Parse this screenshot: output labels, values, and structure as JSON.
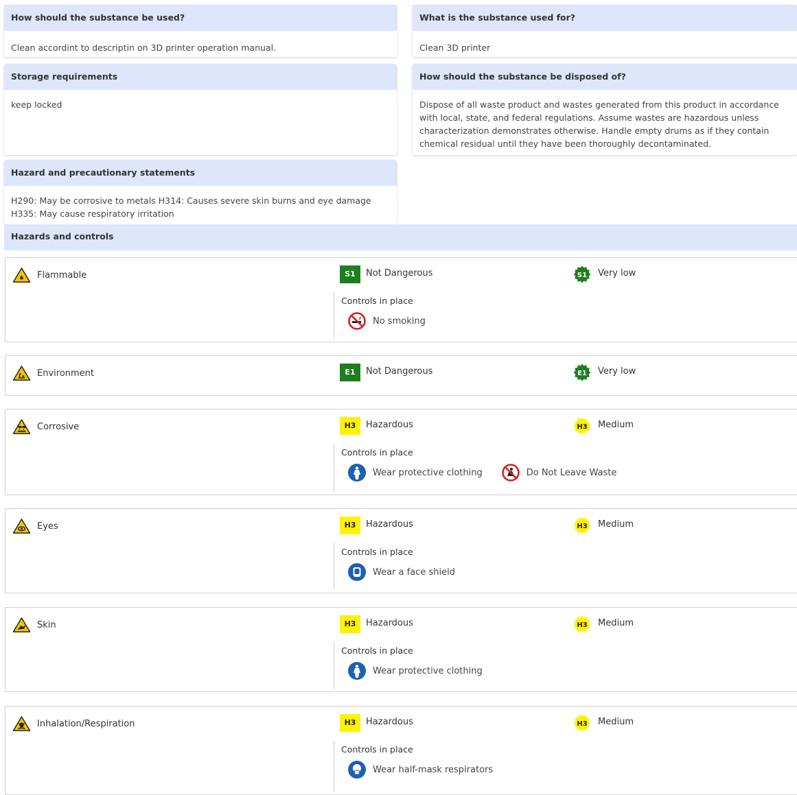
{
  "usage": {
    "title": "How should the substance be used?",
    "text": "Clean accordint to descriptin on 3D printer operation manual."
  },
  "purpose": {
    "title": "What is the substance used for?",
    "text": "Clean 3D printer"
  },
  "storage": {
    "title": "Storage requirements",
    "text": "keep locked"
  },
  "disposal": {
    "title": "How should the substance be disposed of?",
    "text": "Dispose of all waste product and wastes generated from this product in accordance with local, state, and federal regulations. Assume wastes are hazardous unless characterization demonstrates otherwise. Handle empty drums as if they contain chemical residual until they have been thoroughly decontaminated."
  },
  "statements": {
    "title": "Hazard and precautionary statements",
    "text": "H290: May be corrosive to metals H314: Causes severe skin burns and eye damage H335: May cause respiratory irritation"
  },
  "hazards_title": "Hazards and controls",
  "controls_label": "Controls in place",
  "colors": {
    "header_bg": "#dde6fb",
    "not_dangerous_green": "#1e7e1e",
    "hazardous_yellow": "#fff200",
    "warning_triangle": "#f5c400",
    "mandatory_blue": "#1f5fb4",
    "prohibition_red": "#d81e1e"
  },
  "hazards": [
    {
      "name": "Flammable",
      "icon": "flame-hazard-icon",
      "severity_code": "S1",
      "severity_label": "Not Dangerous",
      "severity_level": "safe",
      "risk_code": "S1",
      "risk_label": "Very low",
      "controls": [
        {
          "label": "No smoking",
          "icon": "no-smoking-icon",
          "kind": "prohibition"
        }
      ]
    },
    {
      "name": "Environment",
      "icon": "environment-hazard-icon",
      "severity_code": "E1",
      "severity_label": "Not Dangerous",
      "severity_level": "safe",
      "risk_code": "E1",
      "risk_label": "Very low",
      "controls": []
    },
    {
      "name": "Corrosive",
      "icon": "corrosive-hazard-icon",
      "severity_code": "H3",
      "severity_label": "Hazardous",
      "severity_level": "hazard",
      "risk_code": "H3",
      "risk_label": "Medium",
      "controls": [
        {
          "label": "Wear protective clothing",
          "icon": "protective-clothing-icon",
          "kind": "mandatory"
        },
        {
          "label": "Do Not Leave Waste",
          "icon": "no-waste-icon",
          "kind": "prohibition"
        }
      ]
    },
    {
      "name": "Eyes",
      "icon": "eye-hazard-icon",
      "severity_code": "H3",
      "severity_label": "Hazardous",
      "severity_level": "hazard",
      "risk_code": "H3",
      "risk_label": "Medium",
      "controls": [
        {
          "label": "Wear a face shield",
          "icon": "face-shield-icon",
          "kind": "mandatory"
        }
      ]
    },
    {
      "name": "Skin",
      "icon": "skin-hazard-icon",
      "severity_code": "H3",
      "severity_label": "Hazardous",
      "severity_level": "hazard",
      "risk_code": "H3",
      "risk_label": "Medium",
      "controls": [
        {
          "label": "Wear protective clothing",
          "icon": "protective-clothing-icon",
          "kind": "mandatory"
        }
      ]
    },
    {
      "name": "Inhalation/Respiration",
      "icon": "inhalation-hazard-icon",
      "severity_code": "H3",
      "severity_label": "Hazardous",
      "severity_level": "hazard",
      "risk_code": "H3",
      "risk_label": "Medium",
      "controls": [
        {
          "label": "Wear half-mask respirators",
          "icon": "respirator-icon",
          "kind": "mandatory"
        }
      ]
    }
  ]
}
